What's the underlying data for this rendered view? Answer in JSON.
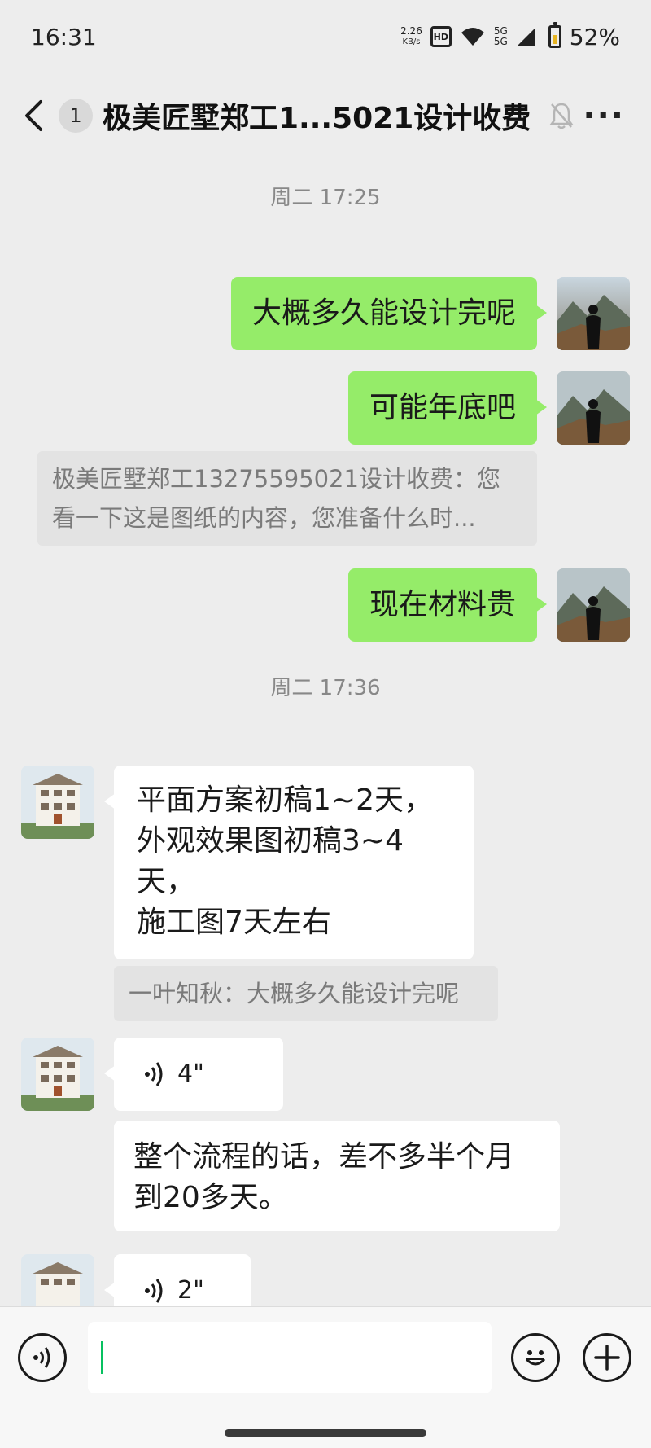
{
  "status_bar": {
    "time": "16:31",
    "net_speed_value": "2.26",
    "net_speed_unit": "KB/s",
    "hd_label": "HD",
    "signal_top": "5G",
    "signal_bottom": "5G",
    "battery": "52%",
    "battery_level": 0.52
  },
  "header": {
    "unread_count": "1",
    "title": "极美匠墅郑工1...5021设计收费",
    "back_icon": "chevron-left-icon",
    "mute_icon": "bell-muted-icon",
    "more_icon": "more-dots-icon",
    "more_glyph": "···"
  },
  "messages": {
    "ts1": "周二 17:25",
    "m1": "大概多久能设计完呢",
    "m2": "可能年底吧",
    "quote1": "极美匠墅郑工13275595021设计收费：您看一下这是图纸的内容，您准备什么时...",
    "m3": "现在材料贵",
    "ts2": "周二 17:36",
    "r1_lines": [
      "平面方案初稿1~2天，",
      "外观效果图初稿3~4",
      "天，",
      "施工图7天左右"
    ],
    "quote2": "一叶知秋：大概多久能设计完呢",
    "voice1": "4\"",
    "r2_lines": [
      "整个流程的话，差不多半个月",
      "到20多天。"
    ],
    "voice2": "2\""
  },
  "input_bar": {
    "voice_icon": "voice-input-icon",
    "emoji_icon": "emoji-icon",
    "plus_icon": "plus-icon"
  },
  "colors": {
    "background": "#ededed",
    "my_bubble": "#95ec69",
    "their_bubble": "#ffffff",
    "quote_bg": "#e3e3e3",
    "caret": "#07c160"
  }
}
